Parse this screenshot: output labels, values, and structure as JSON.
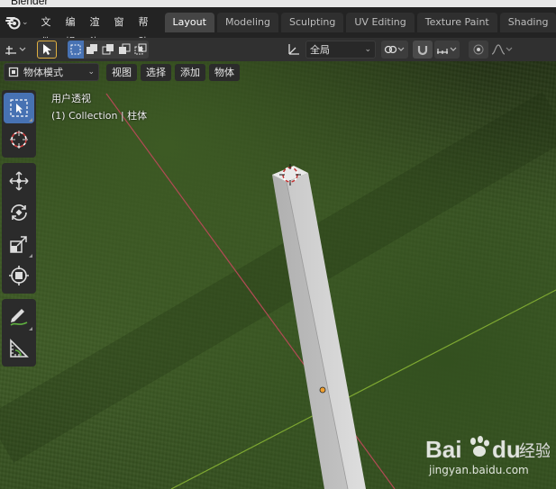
{
  "window": {
    "title": "Blender"
  },
  "menu": {
    "items": [
      "文件",
      "编辑",
      "渲染",
      "窗口",
      "帮助"
    ]
  },
  "workspaces": {
    "tabs": [
      {
        "label": "Layout",
        "active": true
      },
      {
        "label": "Modeling",
        "active": false
      },
      {
        "label": "Sculpting",
        "active": false
      },
      {
        "label": "UV Editing",
        "active": false
      },
      {
        "label": "Texture Paint",
        "active": false
      },
      {
        "label": "Shading",
        "active": false
      }
    ]
  },
  "header": {
    "transform_orientation": "全局"
  },
  "viewport_header": {
    "mode": "物体模式",
    "menus": [
      "视图",
      "选择",
      "添加",
      "物体"
    ]
  },
  "viewport": {
    "view_name": "用户透视",
    "collection_info": "(1) Collection | 柱体"
  },
  "tools": [
    {
      "name": "select-box",
      "active": true
    },
    {
      "name": "cursor",
      "active": false
    },
    {
      "name": "move",
      "active": false
    },
    {
      "name": "rotate",
      "active": false
    },
    {
      "name": "scale",
      "active": false
    },
    {
      "name": "transform",
      "active": false
    },
    {
      "name": "annotate",
      "active": false
    },
    {
      "name": "measure",
      "active": false
    }
  ],
  "watermark": {
    "brand_latin": "Bai",
    "brand_latin_end": "du",
    "brand_cn": "经验",
    "url": "jingyan.baidu.com"
  },
  "colors": {
    "accent": "#4772b3",
    "x_axis": "#b24a55",
    "y_axis": "#7ea832",
    "origin": "#f0a030"
  }
}
